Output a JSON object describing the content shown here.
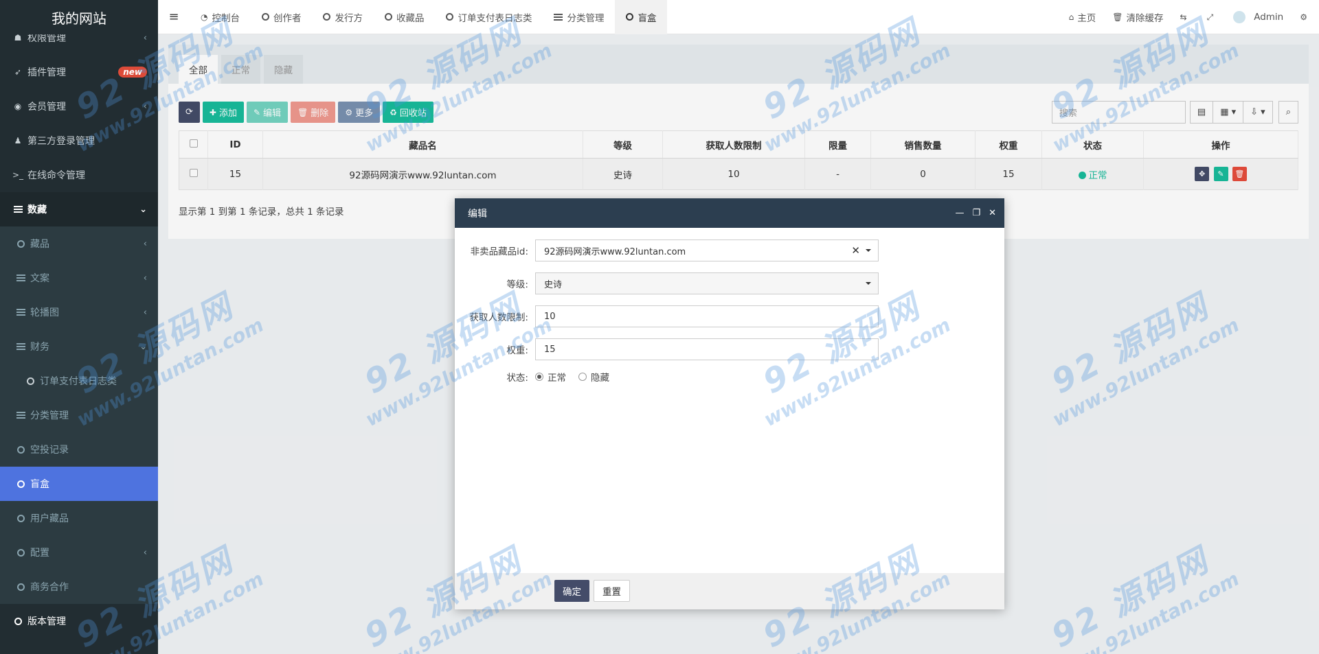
{
  "brand": "我的网站",
  "sidebar": {
    "items": [
      {
        "label": "权限管理",
        "icon": "group-icon"
      },
      {
        "label": "插件管理",
        "icon": "rocket-icon",
        "badge": "new"
      },
      {
        "label": "会员管理",
        "icon": "user-circle-icon"
      },
      {
        "label": "第三方登录管理",
        "icon": "users-icon"
      },
      {
        "label": "在线命令管理",
        "icon": "terminal-icon"
      },
      {
        "label": "数藏",
        "icon": "list-icon"
      },
      {
        "label": "藏品",
        "icon": "circle-icon"
      },
      {
        "label": "文案",
        "icon": "list-icon"
      },
      {
        "label": "轮播图",
        "icon": "list-icon"
      },
      {
        "label": "财务",
        "icon": "list-icon"
      },
      {
        "label": "订单支付表日志类",
        "icon": "circle-icon"
      },
      {
        "label": "分类管理",
        "icon": "list-icon"
      },
      {
        "label": "空投记录",
        "icon": "circle-icon"
      },
      {
        "label": "盲盒",
        "icon": "circle-icon"
      },
      {
        "label": "用户藏品",
        "icon": "circle-icon"
      },
      {
        "label": "配置",
        "icon": "circle-icon"
      },
      {
        "label": "商务合作",
        "icon": "circle-icon"
      },
      {
        "label": "版本管理",
        "icon": "circle-icon"
      }
    ]
  },
  "topnav": {
    "tabs": [
      {
        "label": "控制台",
        "icon": "dashboard-icon"
      },
      {
        "label": "创作者",
        "icon": "circle-icon"
      },
      {
        "label": "发行方",
        "icon": "circle-icon"
      },
      {
        "label": "收藏品",
        "icon": "circle-icon"
      },
      {
        "label": "订单支付表日志类",
        "icon": "circle-icon"
      },
      {
        "label": "分类管理",
        "icon": "list-icon"
      },
      {
        "label": "盲盒",
        "icon": "circle-icon"
      }
    ],
    "right": {
      "home": "主页",
      "clear_cache": "清除缓存",
      "user": "Admin"
    }
  },
  "panel": {
    "tabs": [
      "全部",
      "正常",
      "隐藏"
    ],
    "toolbar": {
      "add": "添加",
      "edit": "编辑",
      "delete": "删除",
      "more": "更多",
      "recycle": "回收站"
    },
    "search_placeholder": "搜索",
    "table": {
      "headers": [
        "ID",
        "藏品名",
        "等级",
        "获取人数限制",
        "限量",
        "销售数量",
        "权重",
        "状态",
        "操作"
      ],
      "rows": [
        {
          "id": "15",
          "name": "92源码网演示www.92luntan.com",
          "level": "史诗",
          "limit": "10",
          "quantity": "-",
          "sold": "0",
          "weight": "15",
          "status": "正常"
        }
      ]
    },
    "footer": "显示第 1 到第 1 条记录，总共 1 条记录"
  },
  "modal": {
    "title": "编辑",
    "fields": {
      "item_label": "非卖品藏品id:",
      "item_value": "92源码网演示www.92luntan.com",
      "level_label": "等级:",
      "level_value": "史诗",
      "limit_label": "获取人数限制:",
      "limit_value": "10",
      "weight_label": "权重:",
      "weight_value": "15",
      "status_label": "状态:",
      "status_options": [
        "正常",
        "隐藏"
      ]
    },
    "buttons": {
      "ok": "确定",
      "reset": "重置"
    }
  },
  "watermark": {
    "big": "92 源码网",
    "small": "www.92luntan.com"
  }
}
